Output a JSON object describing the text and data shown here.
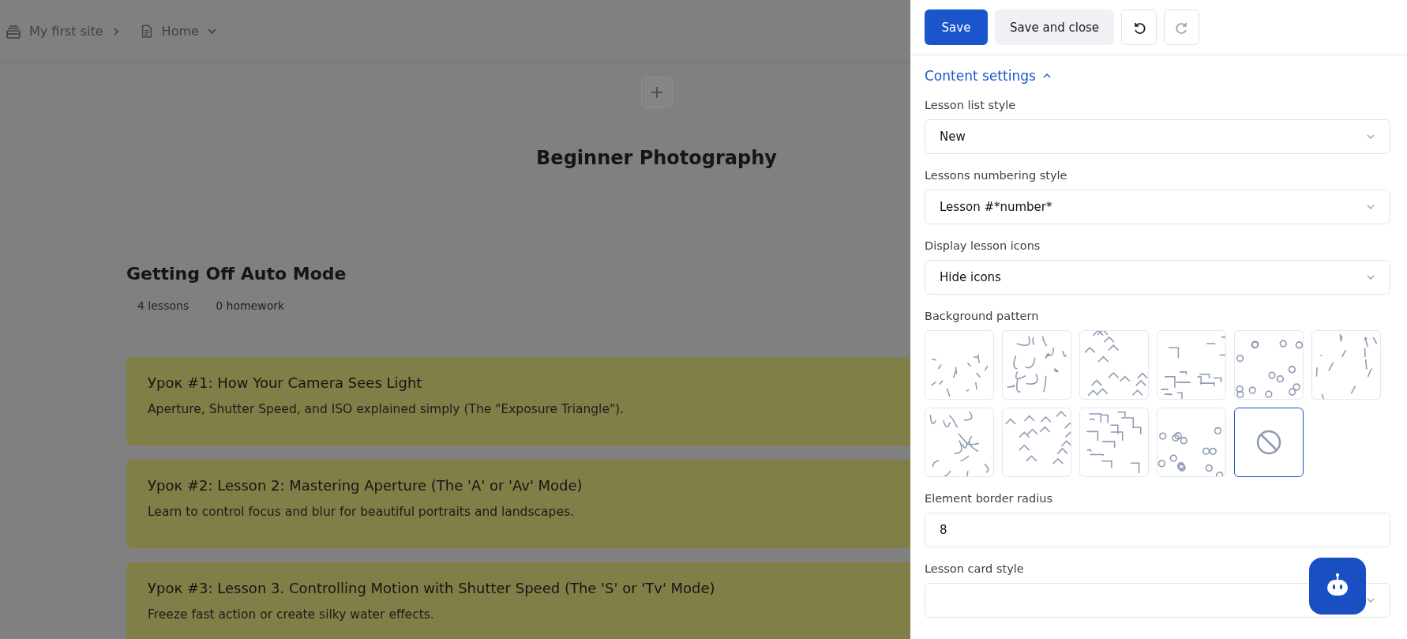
{
  "breadcrumb": {
    "site": "My first site",
    "page": "Home"
  },
  "page": {
    "title": "Beginner Photography",
    "section": {
      "title": "Getting Off Auto Mode",
      "stats": [
        "4 lessons",
        "0 homework"
      ]
    },
    "lessons": [
      {
        "title": "Урок #1: How Your Camera Sees Light",
        "description": "Aperture, Shutter Speed, and ISO explained simply (The \"Exposure Triangle\")."
      },
      {
        "title": "Урок #2: Lesson 2: Mastering Aperture (The 'A' or 'Av' Mode)",
        "description": "Learn to control focus and blur for beautiful portraits and landscapes."
      },
      {
        "title": "Урок #3: Lesson 3. Controlling Motion with Shutter Speed (The 'S' or 'Tv' Mode)",
        "description": "Freeze fast action or create silky water effects."
      }
    ]
  },
  "toolbar": {
    "save": "Save",
    "save_close": "Save and close",
    "undo_disabled": false,
    "redo_disabled": true
  },
  "settings": {
    "title": "Content settings",
    "expanded": true,
    "fields": [
      {
        "kind": "select",
        "label": "Lesson list style",
        "value": "New"
      },
      {
        "kind": "select",
        "label": "Lessons numbering style",
        "value": "Lesson #*number*"
      },
      {
        "kind": "select",
        "label": "Display lesson icons",
        "value": "Hide icons"
      },
      {
        "kind": "patterns",
        "label": "Background pattern"
      },
      {
        "kind": "input",
        "label": "Element border radius",
        "value": "8"
      },
      {
        "kind": "select",
        "label": "Lesson card style"
      }
    ],
    "patterns": [
      {
        "kind": "pattern",
        "selected": false
      },
      {
        "kind": "pattern",
        "selected": false
      },
      {
        "kind": "pattern",
        "selected": false
      },
      {
        "kind": "pattern",
        "selected": false
      },
      {
        "kind": "pattern",
        "selected": false
      },
      {
        "kind": "pattern",
        "selected": false
      },
      {
        "kind": "pattern",
        "selected": false
      },
      {
        "kind": "pattern",
        "selected": false
      },
      {
        "kind": "pattern",
        "selected": false
      },
      {
        "kind": "pattern",
        "selected": false
      },
      {
        "kind": "none",
        "selected": true
      }
    ]
  }
}
